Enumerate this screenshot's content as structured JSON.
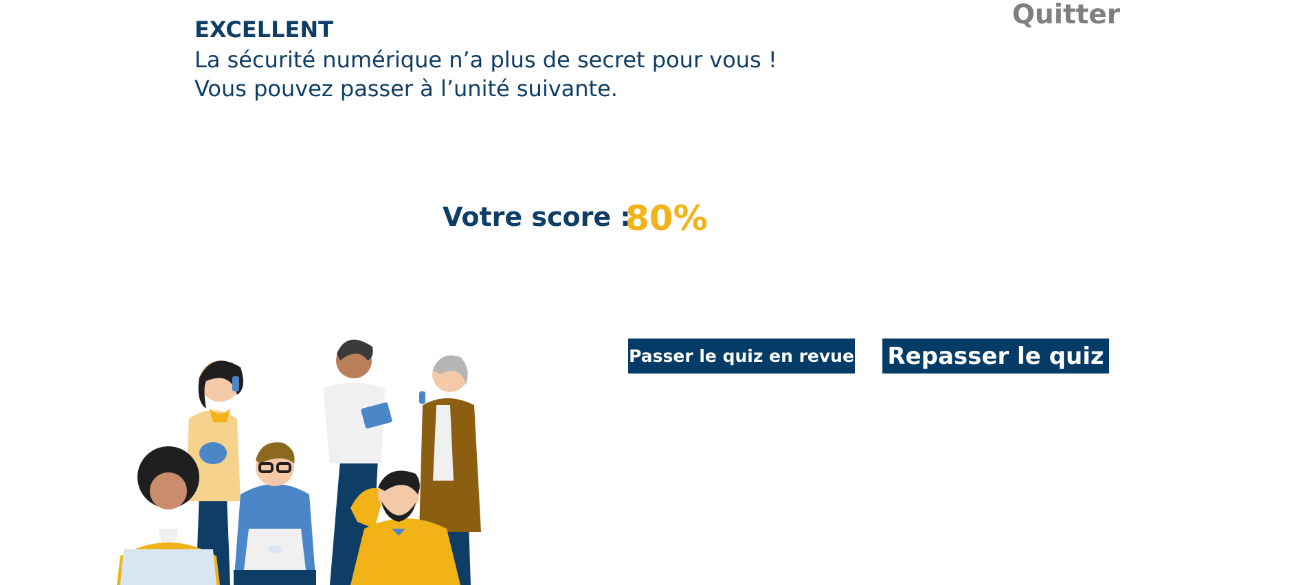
{
  "header": {
    "quit_label": "Quitter"
  },
  "result": {
    "headline": "EXCELLENT",
    "message_line1": "La sécurité numérique n’a plus de secret pour vous !",
    "message_line2": "Vous pouvez passer à l’unité suivante.",
    "score_label": "Votre score :",
    "score_value": "80%"
  },
  "actions": {
    "review_label": "Passer le quiz en revue",
    "retry_label": "Repasser le quiz"
  },
  "colors": {
    "primary": "#0e3d66",
    "button": "#053b67",
    "accent": "#f2b318",
    "muted": "#7f7f7f"
  },
  "illustration": {
    "icon": "people-group-illustration"
  }
}
